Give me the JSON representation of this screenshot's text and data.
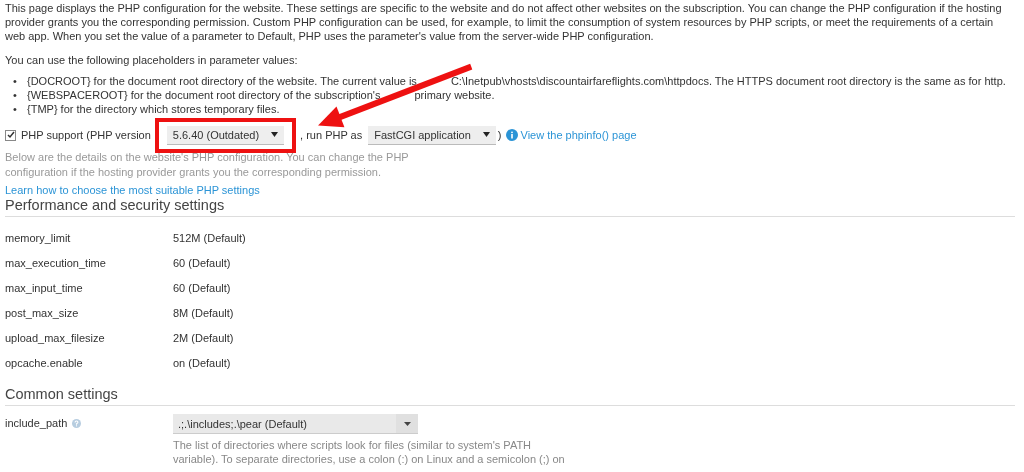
{
  "intro": "This page displays the PHP configuration for the website. These settings are specific to the website and do not affect other websites on the subscription. You can change the PHP configuration if the hosting provider grants you the corresponding permission. Custom PHP configuration can be used, for example, to limit the consumption of system resources by PHP scripts, or meet the requirements of a certain web app. When you set the value of a parameter to Default, PHP uses the parameter's value from the server-wide PHP configuration.",
  "placeholders_intro": "You can use the following placeholders in parameter values:",
  "placeholders": [
    {
      "bullet": "•",
      "parts": [
        "{DOCROOT} for the document root directory of the website. The current value is",
        "C:\\Inetpub\\vhosts\\discountairfareflights.com\\httpdocs. The HTTPS document root directory is the same as for http."
      ]
    },
    {
      "bullet": "•",
      "parts": [
        "{WEBSPACEROOT} for the document root directory of the subscription's",
        "primary website."
      ]
    },
    {
      "bullet": "•",
      "parts": [
        "{TMP} for the directory which stores temporary files."
      ]
    }
  ],
  "php_support": {
    "checked": true,
    "label": "PHP support (PHP version",
    "version": "5.6.40 (Outdated)",
    "run_as_label": ", run PHP as",
    "handler": "FastCGI application",
    "closing": ")",
    "phpinfo_link": "View the phpinfo() page"
  },
  "description": "Below are the details on the website's PHP configuration. You can change the PHP configuration if the hosting provider grants you the corresponding permission.",
  "learn_link": "Learn how to choose the most suitable PHP settings",
  "sections": [
    {
      "title": "Performance and security settings",
      "rows": [
        {
          "kind": "text",
          "name": "memory_limit",
          "value": "512M (Default)"
        },
        {
          "kind": "text",
          "name": "max_execution_time",
          "value": "60 (Default)"
        },
        {
          "kind": "text",
          "name": "max_input_time",
          "value": "60 (Default)"
        },
        {
          "kind": "text",
          "name": "post_max_size",
          "value": "8M (Default)"
        },
        {
          "kind": "text",
          "name": "upload_max_filesize",
          "value": "2M (Default)"
        },
        {
          "kind": "text",
          "name": "opcache.enable",
          "value": "on (Default)"
        }
      ]
    },
    {
      "title": "Common settings",
      "rows": [
        {
          "kind": "combo",
          "name": "include_path",
          "help": true,
          "value": ".;.\\includes;.\\pear (Default)",
          "hint": "The list of directories where scripts look for files (similar to system's PATH variable). To separate directories, use a colon (:) on Linux and a semicolon (;) on"
        }
      ]
    }
  ]
}
